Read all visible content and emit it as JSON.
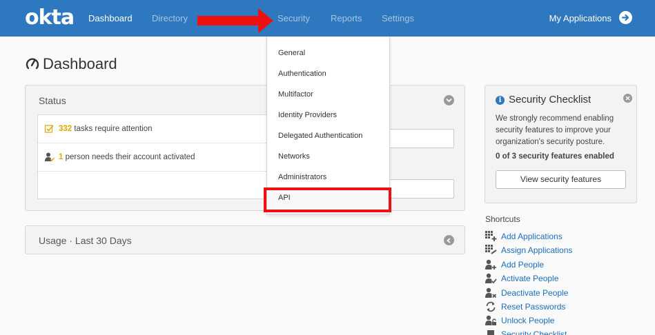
{
  "header": {
    "logo": "okta",
    "nav": [
      {
        "label": "Dashboard",
        "state": "active"
      },
      {
        "label": "Directory",
        "state": "dim"
      },
      {
        "label": "Security",
        "state": "dim"
      },
      {
        "label": "Reports",
        "state": "dim"
      },
      {
        "label": "Settings",
        "state": "dim"
      }
    ],
    "my_applications": "My Applications"
  },
  "page": {
    "title": "Dashboard"
  },
  "status_panel": {
    "title": "Status",
    "rows": [
      {
        "count": "332",
        "text": " tasks require attention"
      },
      {
        "count": "1",
        "text": " person needs their account activated"
      }
    ]
  },
  "usage_panel": {
    "title": "Usage · Last 30 Days"
  },
  "security_menu": {
    "items": [
      "General",
      "Authentication",
      "Multifactor",
      "Identity Providers",
      "Delegated Authentication",
      "Networks",
      "Administrators",
      "API"
    ],
    "highlighted": "API"
  },
  "checklist": {
    "title": "Security Checklist",
    "description": "We strongly recommend enabling security features to improve your organization's security posture.",
    "count": "0 of 3 security features enabled",
    "button": "View security features"
  },
  "shortcuts": {
    "title": "Shortcuts",
    "items": [
      {
        "label": "Add Applications",
        "icon": "add-apps-icon"
      },
      {
        "label": "Assign Applications",
        "icon": "assign-apps-icon"
      },
      {
        "label": "Add People",
        "icon": "add-person-icon"
      },
      {
        "label": "Activate People",
        "icon": "activate-person-icon"
      },
      {
        "label": "Deactivate People",
        "icon": "deactivate-person-icon"
      },
      {
        "label": "Reset Passwords",
        "icon": "refresh-icon"
      },
      {
        "label": "Unlock People",
        "icon": "unlock-icon"
      },
      {
        "label": "Security Checklist",
        "icon": "checklist-icon"
      }
    ]
  },
  "colors": {
    "header": "#2e78bf",
    "link": "#1a6dbf",
    "highlight": "#ee1111",
    "count": "#e0a800"
  }
}
